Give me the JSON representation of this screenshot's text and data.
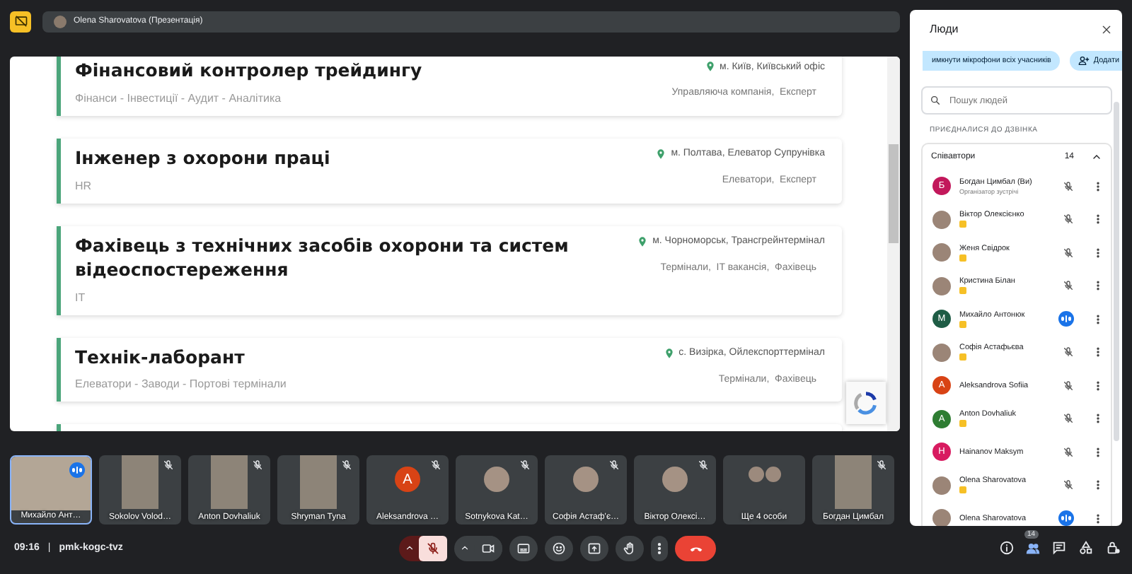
{
  "top_bar": {
    "presenter": "Olena Sharovatova (Презентація)"
  },
  "vacancies": [
    {
      "title": "Фінансовий контролер трейдингу",
      "tags": "Фінанси - Інвестиції - Аудит - Аналітика",
      "location": "м. Київ, Київський офіс",
      "categories": "Управляюча компанія,  Експерт"
    },
    {
      "title": "Інженер з охорони праці",
      "tags": "HR",
      "location": "м. Полтава, Елеватор Супрунівка",
      "categories": "Елеватори,  Експерт"
    },
    {
      "title": "Фахівець з технічних засобів охорони та систем відеоспостереження",
      "tags": "IT",
      "location": "м. Чорноморськ, Трансгрейнтермінал",
      "categories": "Термінали,  IT вакансія,  Фахівець"
    },
    {
      "title": "Технік-лаборант",
      "tags": "Елеватори - Заводи - Портові термінали",
      "location": "с. Визірка, Ойлекспорттермінал",
      "categories": "Термінали,  Фахівець"
    }
  ],
  "tiles": [
    {
      "name": "Михайло Ант…",
      "kind": "video",
      "muted": false,
      "speaking": true
    },
    {
      "name": "Sokolov Volod…",
      "kind": "video",
      "muted": true,
      "speaking": false
    },
    {
      "name": "Anton Dovhaliuk",
      "kind": "video",
      "muted": true,
      "speaking": false
    },
    {
      "name": "Shryman Tyna",
      "kind": "video",
      "muted": true,
      "speaking": false
    },
    {
      "name": "Aleksandrova …",
      "kind": "letter",
      "letter": "A",
      "color": "#d84315",
      "muted": true,
      "speaking": false
    },
    {
      "name": "Sotnykova Kat…",
      "kind": "photo",
      "muted": true,
      "speaking": false
    },
    {
      "name": "Софія Астаф'є…",
      "kind": "photo",
      "muted": true,
      "speaking": false
    },
    {
      "name": "Віктор Олексі…",
      "kind": "photo",
      "muted": true,
      "speaking": false
    },
    {
      "name": "Ще 4 особи",
      "kind": "more",
      "muted": false,
      "speaking": false
    },
    {
      "name": "Богдан Цимбал",
      "kind": "video",
      "muted": true,
      "speaking": false
    }
  ],
  "meeting": {
    "time": "09:16",
    "separator": "|",
    "code": "pmk-kogc-tvz"
  },
  "controls": {
    "mic_muted": true,
    "people_count": "14",
    "people_active": true
  },
  "people_panel": {
    "title": "Люди",
    "buttons": [
      "имкнути мікрофони всіх учасників",
      "Додати"
    ],
    "search": {
      "placeholder": "Пошук людей"
    },
    "section": "ПРИЄДНАЛИСЯ ДО ДЗВІНКА",
    "group": {
      "label": "Співавтори",
      "count": "14",
      "expanded": true
    },
    "people": [
      {
        "name": "Богдан Цимбал (Ви)",
        "subtitle": "Організатор зустрічі",
        "kind": "letter",
        "letter": "Б",
        "color": "#c2185b",
        "cohost": false,
        "speaking": false
      },
      {
        "name": "Віктор Олексієнко",
        "kind": "photo",
        "cohost": true,
        "speaking": false
      },
      {
        "name": "Женя Свідрок",
        "kind": "photo",
        "cohost": true,
        "speaking": false
      },
      {
        "name": "Кристина Білан",
        "kind": "photo",
        "cohost": true,
        "speaking": false
      },
      {
        "name": "Михайло Антонюк",
        "kind": "letter",
        "letter": "М",
        "color": "#1e5c45",
        "cohost": true,
        "speaking": true
      },
      {
        "name": "Софія Астафьєва",
        "kind": "photo",
        "cohost": true,
        "speaking": false
      },
      {
        "name": "Aleksandrova Sofiia",
        "kind": "letter",
        "letter": "A",
        "color": "#d84315",
        "cohost": false,
        "speaking": false
      },
      {
        "name": "Anton Dovhaliuk",
        "kind": "letter",
        "letter": "A",
        "color": "#2e7d32",
        "cohost": true,
        "speaking": false
      },
      {
        "name": "Hainanov Maksym",
        "kind": "letter",
        "letter": "H",
        "color": "#d81b60",
        "cohost": false,
        "speaking": false
      },
      {
        "name": "Olena Sharovatova",
        "kind": "photo",
        "cohost": true,
        "speaking": false
      },
      {
        "name": "Olena Sharovatova",
        "kind": "photo",
        "cohost": false,
        "speaking": true
      }
    ]
  }
}
